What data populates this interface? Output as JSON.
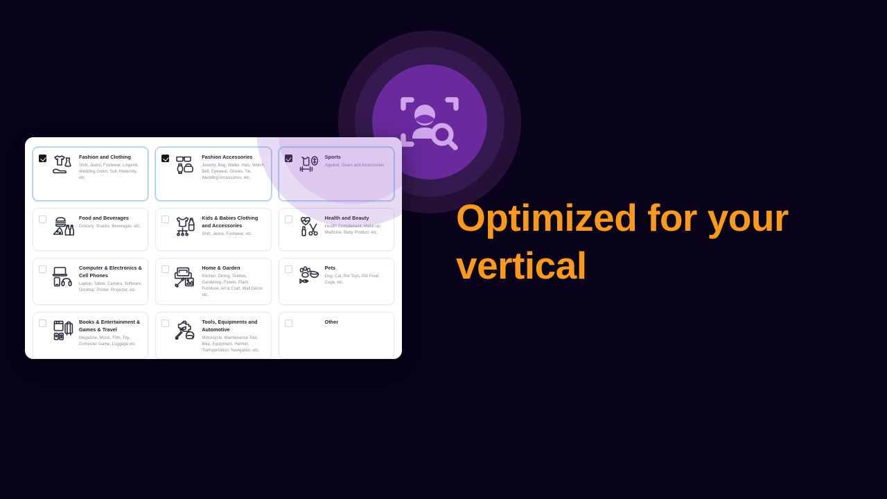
{
  "theme": {
    "background": "#08021a",
    "accent_orange": "#fb9919",
    "accent_purple": "#6a2a9e",
    "ring_mid": "#341a4e",
    "ring_outer": "#251038",
    "card_selected_border": "#9ec9f0"
  },
  "brand": {
    "icon": "face-scan-search-icon"
  },
  "headline": {
    "text": "Optimized for your vertical"
  },
  "panel": {
    "name": "vertical-selector-panel",
    "categories": [
      {
        "id": "fashion-and-clothing",
        "title": "Fashion and Clothing",
        "desc": "Shirt, Jeans, Footwear, Lingerie, Wedding Gown, Suit, Maternity, etc.",
        "checked": true,
        "icon": "tshirt-dress-shoe-icon"
      },
      {
        "id": "fashion-accessories",
        "title": "Fashion Accessories",
        "desc": "Jewelry, Bag, Wallet, Hats, Watch, Belt, Eyewear, Gloves, Tie, Wedding Accessories, etc.",
        "checked": true,
        "icon": "sunglasses-watch-bag-icon"
      },
      {
        "id": "sports",
        "title": "Sports",
        "desc": "Apparel, Gears and Accessories",
        "checked": true,
        "icon": "tanktop-dumbbell-ball-icon"
      },
      {
        "id": "food-and-beverages",
        "title": "Food and Beverages",
        "desc": "Grocery, Snacks, Beverages, etc.",
        "checked": false,
        "icon": "burger-pizza-bottle-icon"
      },
      {
        "id": "kids-and-babies-clothing-and-accessories",
        "title": "Kids & Babies Clothing and Accessories",
        "desc": "Shirt, Jeans, Footwear, etc.",
        "checked": false,
        "icon": "onesie-bottle-mobile-icon"
      },
      {
        "id": "health-and-beauty",
        "title": "Health and Beauty",
        "desc": "Health Complement, Make-up, Medicine, Baby Product, etc.",
        "checked": false,
        "icon": "heart-lipstick-scissors-icon"
      },
      {
        "id": "computer-electronics-cell-phones",
        "title": "Computer & Electronics & Cell Phones",
        "desc": "Laptop, Tablet, Camera, Software, Desktop, Printer, Projector, etc.",
        "checked": false,
        "icon": "laptop-phone-headphones-icon"
      },
      {
        "id": "home-and-garden",
        "title": "Home & Garden",
        "desc": "Kitchen, Dining, Textiles, Gardening, Flower, Plant, Furniture, Art & Craft, Wall Décor, etc.",
        "checked": false,
        "icon": "sofa-shovel-frame-icon"
      },
      {
        "id": "pets",
        "title": "Pets",
        "desc": "Dog, Cat, Pet Toys, Pet Food, Cage, etc.",
        "checked": false,
        "icon": "paw-bowl-fish-icon"
      },
      {
        "id": "books-entertainment-games-travel",
        "title": "Books & Entertainment & Games & Travel",
        "desc": "Magazine, Music, Film, Toy, Computer Game, Luggage etc.",
        "checked": false,
        "icon": "book-gamepad-luggage-icon"
      },
      {
        "id": "tools-equipments-and-automotive",
        "title": "Tools, Equipments and Automotive",
        "desc": "Motorcycle, Maintenance Tool, Bike, Equipment, Helmet, Transportation, Navigation, etc.",
        "checked": false,
        "icon": "engine-wrench-helmet-icon"
      },
      {
        "id": "other",
        "title": "Other",
        "desc": "",
        "checked": false,
        "icon": ""
      }
    ]
  }
}
